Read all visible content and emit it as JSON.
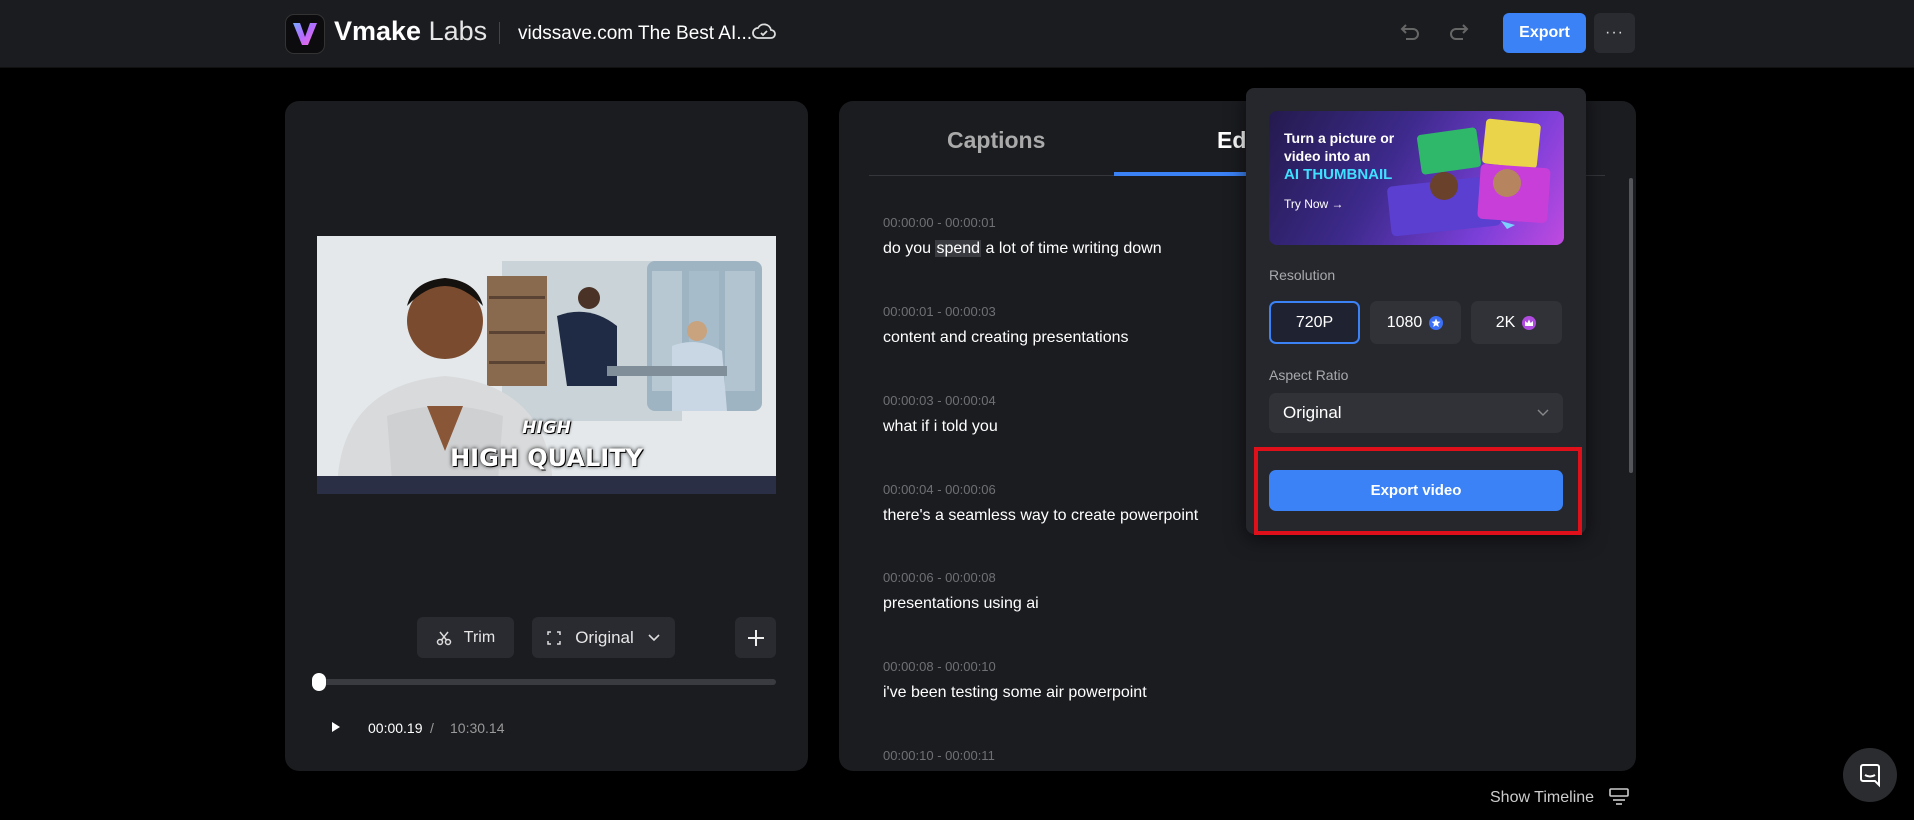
{
  "header": {
    "logo_bold": "Vmake",
    "logo_light": " Labs",
    "project_title": "vidssave.com The Best AI...",
    "export_label": "Export",
    "more_label": "···"
  },
  "player": {
    "caption_small": "HIGH",
    "caption_big": "HIGH QUALITY",
    "trim_label": "Trim",
    "ratio_label": "Original",
    "current_time": "00:00.19",
    "time_separator": "/",
    "total_time": "10:30.14",
    "progress": 0.0003
  },
  "tabs": [
    {
      "label": "Captions"
    },
    {
      "label": "Edi"
    }
  ],
  "captions": [
    {
      "time": "00:00:00 - 00:00:01",
      "pre": "do you ",
      "highlight": "spend",
      "post": " a lot of time writing down"
    },
    {
      "time": "00:00:01 - 00:00:03",
      "text": "content and creating presentations"
    },
    {
      "time": "00:00:03 - 00:00:04",
      "text": "what if i told you"
    },
    {
      "time": "00:00:04 - 00:00:06",
      "text": "there's a seamless way to create powerpoint"
    },
    {
      "time": "00:00:06 - 00:00:08",
      "text": "presentations using ai"
    },
    {
      "time": "00:00:08 - 00:00:10",
      "text": "i've been testing some air powerpoint"
    },
    {
      "time": "00:00:10 - 00:00:11",
      "text": ""
    }
  ],
  "export_panel": {
    "banner_line1": "Turn a picture or",
    "banner_line2": "video into an",
    "banner_line3": "AI THUMBNAIL",
    "banner_cta": "Try Now →",
    "resolution_label": "Resolution",
    "resolutions": [
      {
        "label": "720P",
        "selected": true
      },
      {
        "label": "1080",
        "selected": false
      },
      {
        "label": "2K",
        "selected": false
      }
    ],
    "aspect_ratio_label": "Aspect Ratio",
    "aspect_ratio_value": "Original",
    "export_video_label": "Export video"
  },
  "footer": {
    "show_timeline_label": "Show Timeline"
  },
  "colors": {
    "accent": "#3b82f6",
    "highlight": "#e0101a",
    "panel": "#1b1c20",
    "background": "#000000"
  }
}
